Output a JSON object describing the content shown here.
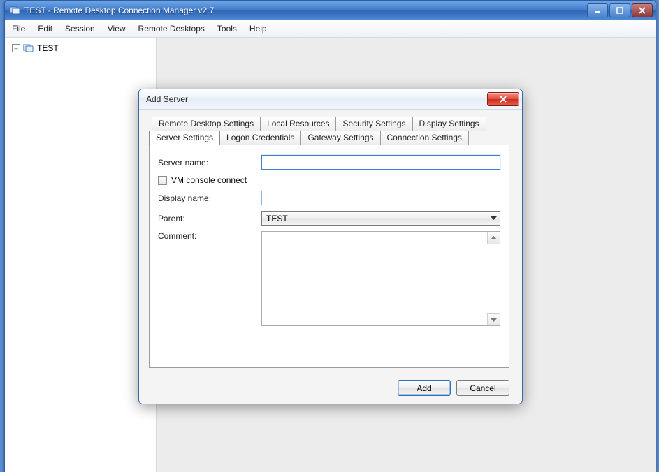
{
  "window": {
    "title": "TEST - Remote Desktop Connection Manager v2.7"
  },
  "menu": {
    "file": "File",
    "edit": "Edit",
    "session": "Session",
    "view": "View",
    "remote_desktops": "Remote Desktops",
    "tools": "Tools",
    "help": "Help"
  },
  "tree": {
    "root_label": "TEST",
    "toggle_glyph": "–"
  },
  "dialog": {
    "title": "Add Server",
    "tabs_top": {
      "remote_desktop": "Remote Desktop Settings",
      "local_resources": "Local Resources",
      "security_settings": "Security Settings",
      "display_settings": "Display Settings"
    },
    "tabs_bottom": {
      "server_settings": "Server Settings",
      "logon_credentials": "Logon Credentials",
      "gateway_settings": "Gateway Settings",
      "connection_settings": "Connection Settings"
    },
    "form": {
      "server_name_label": "Server name:",
      "server_name_value": "",
      "vm_console_label": "VM console connect",
      "display_name_label": "Display name:",
      "display_name_value": "",
      "parent_label": "Parent:",
      "parent_selected": "TEST",
      "comment_label": "Comment:",
      "comment_value": ""
    },
    "buttons": {
      "add": "Add",
      "cancel": "Cancel"
    }
  }
}
